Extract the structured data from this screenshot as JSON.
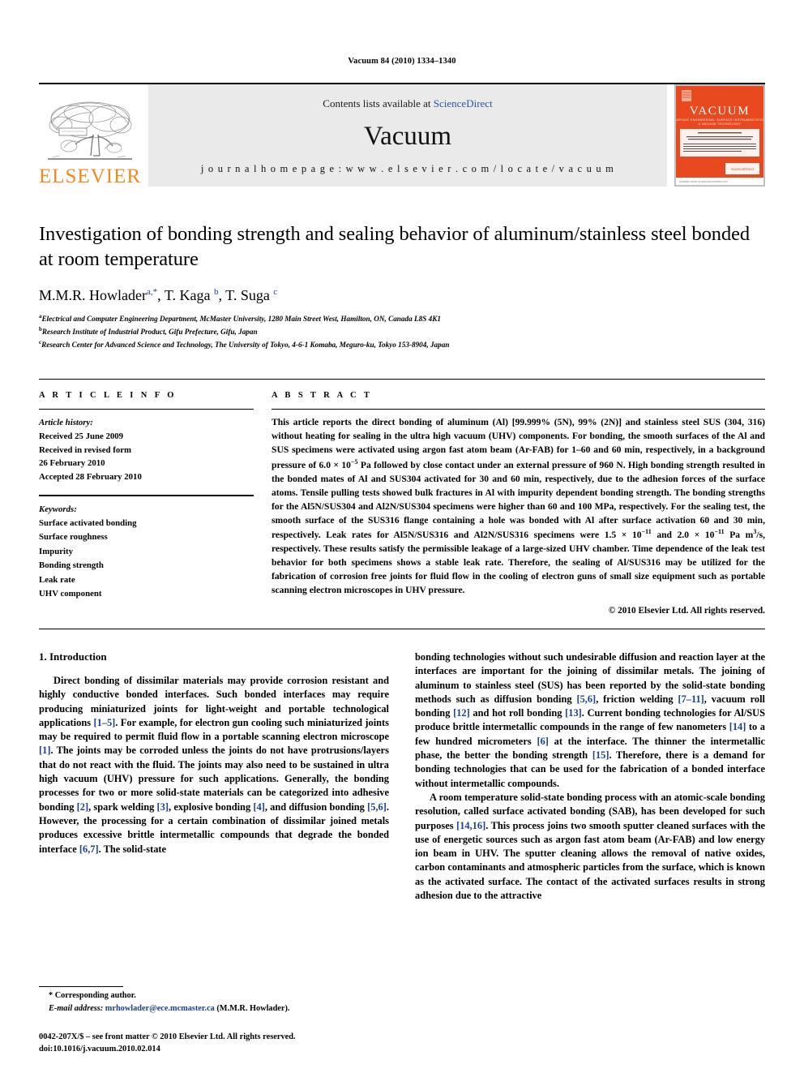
{
  "running_head": "Vacuum 84 (2010) 1334–1340",
  "masthead": {
    "contents_prefix": "Contents lists available at ",
    "sciencedirect": "ScienceDirect",
    "journal_name": "Vacuum",
    "homepage": "j o u r n a l   h o m e p a g e :   w w w . e l s e v i e r . c o m / l o c a t e / v a c u u m",
    "publisher_wordmark": "ELSEVIER",
    "cover_title": "VACUUM",
    "cover_subtitle": "SURFACE ENGINEERING, SURFACE INSTRUMENTATION & VACUUM TECHNOLOGY",
    "cover_footer": "ScienceDirect",
    "brand_orange": "#f08a1e",
    "cover_orange": "#e8491f",
    "link_blue": "#2b55a8"
  },
  "article": {
    "title": "Investigation of bonding strength and sealing behavior of aluminum/stainless steel bonded at room temperature",
    "authors": [
      {
        "name": "M.M.R. Howlader",
        "marks": "a,*"
      },
      {
        "name": "T. Kaga",
        "marks": "b"
      },
      {
        "name": "T. Suga",
        "marks": "c"
      }
    ],
    "affiliations": [
      {
        "mark": "a",
        "text": "Electrical and Computer Engineering Department, McMaster University, 1280 Main Street West, Hamilton, ON, Canada L8S 4K1"
      },
      {
        "mark": "b",
        "text": "Research Institute of Industrial Product, Gifu Prefecture, Gifu, Japan"
      },
      {
        "mark": "c",
        "text": "Research Center for Advanced Science and Technology, The University of Tokyo, 4-6-1 Komaba, Meguro-ku, Tokyo 153-8904, Japan"
      }
    ]
  },
  "article_info": {
    "heading": "A R T I C L E   I N F O",
    "history_label": "Article history:",
    "history": [
      "Received 25 June 2009",
      "Received in revised form",
      "26 February 2010",
      "Accepted 28 February 2010"
    ],
    "keywords_label": "Keywords:",
    "keywords": [
      "Surface activated bonding",
      "Surface roughness",
      "Impurity",
      "Bonding strength",
      "Leak rate",
      "UHV component"
    ]
  },
  "abstract": {
    "heading": "A B S T R A C T",
    "text_part1": "This article reports the direct bonding of aluminum (Al) [99.999% (5N), 99% (2N)] and stainless steel SUS (304, 316) without heating for sealing in the ultra high vacuum (UHV) components. For bonding, the smooth surfaces of the Al and SUS specimens were activated using argon fast atom beam (Ar-FAB) for 1–60 and 60 min, respectively, in a background pressure of 6.0 × 10",
    "exp1": "−5",
    "text_part2": " Pa followed by close contact under an external pressure of 960 N. High bonding strength resulted in the bonded mates of Al and SUS304 activated for 30 and 60 min, respectively, due to the adhesion forces of the surface atoms. Tensile pulling tests showed bulk fractures in Al with impurity dependent bonding strength. The bonding strengths for the Al5N/SUS304 and Al2N/SUS304 specimens were higher than 60 and 100 MPa, respectively. For the sealing test, the smooth surface of the SUS316 flange containing a hole was bonded with Al after surface activation 60 and 30 min, respectively. Leak rates for Al5N/SUS316 and Al2N/SUS316 specimens were 1.5 × 10",
    "exp2": "−11",
    "text_part3": " and 2.0 × 10",
    "exp3": "−11",
    "text_part4": " Pa m",
    "exp4": "3",
    "text_part5": "/s, respectively. These results satisfy the permissible leakage of a large-sized UHV chamber. Time dependence of the leak test behavior for both specimens shows a stable leak rate. Therefore, the sealing of Al/SUS316 may be utilized for the fabrication of corrosion free joints for fluid flow in the cooling of electron guns of small size equipment such as portable scanning electron microscopes in UHV pressure.",
    "copyright": "© 2010 Elsevier Ltd. All rights reserved."
  },
  "introduction": {
    "section_number_title": "1.  Introduction",
    "left_paragraphs": [
      {
        "segments": [
          {
            "t": "Direct bonding of dissimilar materials may provide corrosion resistant and highly conductive bonded interfaces. Such bonded interfaces may require producing miniaturized joints for light-weight and portable technological applications "
          },
          {
            "t": "[1–5]",
            "ref": true
          },
          {
            "t": ". For example, for electron gun cooling such miniaturized joints may be required to permit fluid flow in a portable scanning electron microscope "
          },
          {
            "t": "[1]",
            "ref": true
          },
          {
            "t": ". The joints may be corroded unless the joints do not have protrusions/layers that do not react with the fluid. The joints may also need to be sustained in ultra high vacuum (UHV) pressure for such applications. Generally, the bonding processes for two or more solid-state materials can be categorized into adhesive bonding "
          },
          {
            "t": "[2]",
            "ref": true
          },
          {
            "t": ", spark welding "
          },
          {
            "t": "[3]",
            "ref": true
          },
          {
            "t": ", explosive bonding "
          },
          {
            "t": "[4]",
            "ref": true
          },
          {
            "t": ", and diffusion bonding "
          },
          {
            "t": "[5,6]",
            "ref": true
          },
          {
            "t": ". However, the processing for a certain combination of dissimilar joined metals produces excessive brittle intermetallic compounds that degrade the bonded interface "
          },
          {
            "t": "[6,7]",
            "ref": true
          },
          {
            "t": ". The solid-state"
          }
        ]
      }
    ],
    "right_paragraphs": [
      {
        "indent": false,
        "segments": [
          {
            "t": "bonding technologies without such undesirable diffusion and reaction layer at the interfaces are important for the joining of dissimilar metals. The joining of aluminum to stainless steel (SUS) has been reported by the solid-state bonding methods such as diffusion bonding "
          },
          {
            "t": "[5,6]",
            "ref": true
          },
          {
            "t": ", friction welding "
          },
          {
            "t": "[7–11]",
            "ref": true
          },
          {
            "t": ", vacuum roll bonding "
          },
          {
            "t": "[12]",
            "ref": true
          },
          {
            "t": " and hot roll bonding "
          },
          {
            "t": "[13]",
            "ref": true
          },
          {
            "t": ". Current bonding technologies for Al/SUS produce brittle intermetallic compounds in the range of few nanometers "
          },
          {
            "t": "[14]",
            "ref": true
          },
          {
            "t": " to a few hundred micrometers "
          },
          {
            "t": "[6]",
            "ref": true
          },
          {
            "t": " at the interface. The thinner the intermetallic phase, the better the bonding strength "
          },
          {
            "t": "[15]",
            "ref": true
          },
          {
            "t": ". Therefore, there is a demand for bonding technologies that can be used for the fabrication of a bonded interface without intermetallic compounds."
          }
        ]
      },
      {
        "indent": true,
        "segments": [
          {
            "t": "A room temperature solid-state bonding process with an atomic-scale bonding resolution, called surface activated bonding (SAB), has been developed for such purposes "
          },
          {
            "t": "[14,16]",
            "ref": true
          },
          {
            "t": ". This process joins two smooth sputter cleaned surfaces with the use of energetic sources such as argon fast atom beam (Ar-FAB) and low energy ion beam in UHV. The sputter cleaning allows the removal of native oxides, carbon contaminants and atmospheric particles from the surface, which is known as the activated surface. The contact of the activated surfaces results in strong adhesion due to the attractive"
          }
        ]
      }
    ]
  },
  "footnote": {
    "corresponding": "* Corresponding author.",
    "email_label": "E-mail address:",
    "email": "mrhowlader@ece.mcmaster.ca",
    "email_owner": "(M.M.R. Howlader)."
  },
  "page_footer": {
    "line1": "0042-207X/$ – see front matter © 2010 Elsevier Ltd. All rights reserved.",
    "line2": "doi:10.1016/j.vacuum.2010.02.014"
  }
}
